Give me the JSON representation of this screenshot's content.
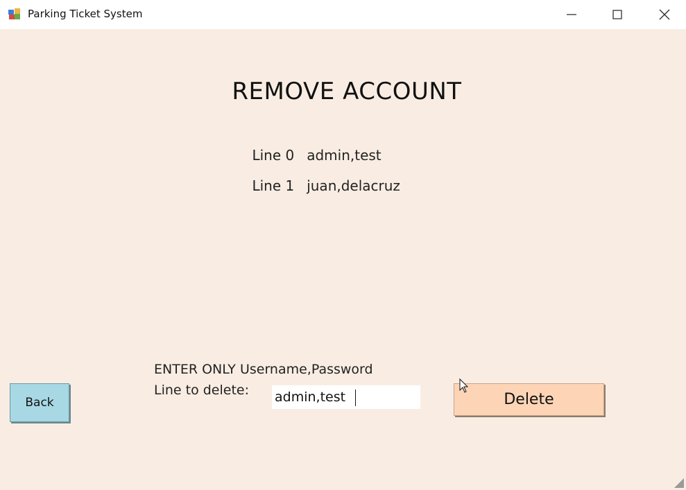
{
  "window": {
    "title": "Parking Ticket System",
    "icon": "app-icon",
    "controls": [
      "minimize-icon",
      "maximize-icon",
      "close-icon"
    ]
  },
  "heading": "REMOVE ACCOUNT",
  "lines": [
    {
      "label": "Line 0",
      "value": "admin,test"
    },
    {
      "label": "Line 1",
      "value": "juan,delacruz"
    }
  ],
  "form": {
    "instruction": "ENTER ONLY Username,Password",
    "line_label": "Line to delete:",
    "input_value": "admin,test"
  },
  "buttons": {
    "back": "Back",
    "delete": "Delete"
  },
  "colors": {
    "background": "#f9ede3",
    "back_button": "#a7d8e4",
    "delete_button": "#fdd5b6"
  }
}
